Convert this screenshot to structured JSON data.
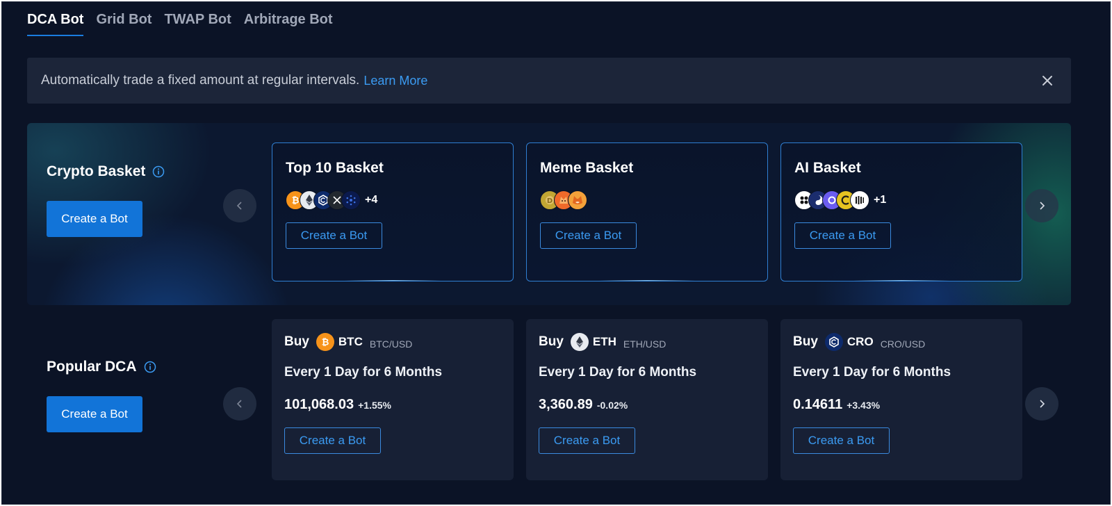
{
  "tabs": [
    {
      "label": "DCA Bot",
      "active": true
    },
    {
      "label": "Grid Bot",
      "active": false
    },
    {
      "label": "TWAP Bot",
      "active": false
    },
    {
      "label": "Arbitrage Bot",
      "active": false
    }
  ],
  "banner": {
    "text": "Automatically trade a fixed amount at regular intervals.",
    "link": "Learn More"
  },
  "basket_section": {
    "title": "Crypto Basket",
    "create_label": "Create a Bot",
    "cards": [
      {
        "title": "Top 10 Basket",
        "coins": [
          "bitcoin-icon",
          "ethereum-icon",
          "cronos-icon",
          "xrp-icon",
          "cardano-icon"
        ],
        "more": "+4",
        "button": "Create a Bot"
      },
      {
        "title": "Meme Basket",
        "coins": [
          "dogecoin-icon",
          "floki-icon",
          "shiba-icon"
        ],
        "more": "",
        "button": "Create a Bot"
      },
      {
        "title": "AI Basket",
        "coins": [
          "ai-coin-1-icon",
          "ai-coin-2-icon",
          "ai-coin-3-icon",
          "ai-coin-4-icon",
          "ai-coin-5-icon"
        ],
        "more": "+1",
        "button": "Create a Bot"
      }
    ]
  },
  "popular_section": {
    "title": "Popular DCA",
    "create_label": "Create a Bot",
    "cards": [
      {
        "buy": "Buy",
        "symbol": "BTC",
        "pair": "BTC/USD",
        "frequency": "Every 1 Day for 6 Months",
        "price": "101,068.03",
        "change": "+1.55%",
        "button": "Create a Bot"
      },
      {
        "buy": "Buy",
        "symbol": "ETH",
        "pair": "ETH/USD",
        "frequency": "Every 1 Day for 6 Months",
        "price": "3,360.89",
        "change": "-0.02%",
        "button": "Create a Bot"
      },
      {
        "buy": "Buy",
        "symbol": "CRO",
        "pair": "CRO/USD",
        "frequency": "Every 1 Day for 6 Months",
        "price": "0.14611",
        "change": "+3.43%",
        "button": "Create a Bot"
      }
    ]
  },
  "colors": {
    "background": "#0b1326",
    "accent": "#1274d8",
    "link": "#3b9bf2",
    "card": "#172035"
  }
}
